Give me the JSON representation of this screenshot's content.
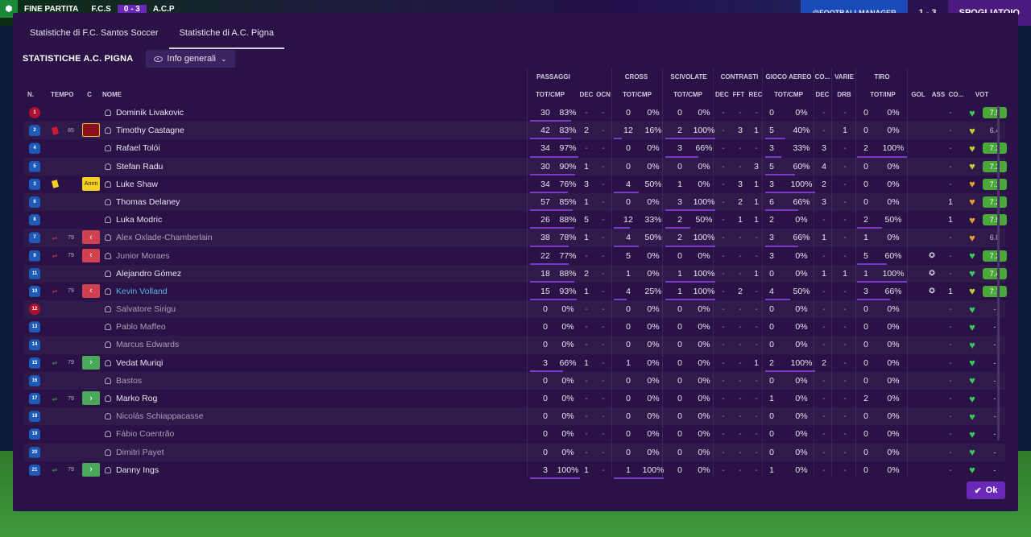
{
  "topbar": {
    "match_status": "FINE PARTITA",
    "home_short": "F.C.S",
    "score": "0 - 3",
    "away_short": "A.C.P",
    "right_score": "1 - 3",
    "right_label": "SPOGLIATOIO",
    "social": "@FOOTBALLMANAGER"
  },
  "tabs": [
    {
      "label": "Statistiche di F.C. Santos Soccer"
    },
    {
      "label": "Statistiche di A.C. Pigna"
    }
  ],
  "title": "STATISTICHE A.C. PIGNA",
  "view_dropdown": "Info generali",
  "ok_label": "Ok",
  "groups": [
    "PASSAGGI",
    "CROSS",
    "SCIVOLATE",
    "CONTRASTI",
    "GIOCO AEREO",
    "CO...",
    "VARIE",
    "TIRO"
  ],
  "columns": {
    "n": "N.",
    "tempo": "TEMPO",
    "c": "C",
    "nome": "NOME",
    "pass_totcmp": "TOT/CMP",
    "pass_dec": "DEC",
    "pass_ocn": "OCN",
    "cross_totcmp": "TOT/CMP",
    "sciv_totcmp": "TOT/CMP",
    "con_dec": "DEC",
    "con_fft": "FFT",
    "con_rec": "REC",
    "aereo_totcmp": "TOT/CMP",
    "co_dec": "DEC",
    "varie_drb": "DRB",
    "tiro_totinp": "TOT/INP",
    "gol": "GOL",
    "ass": "ASS",
    "co": "CO...",
    "vot": "VOT"
  },
  "players": [
    {
      "n": "1",
      "type": "gk",
      "name": "Dominik Livakovic",
      "style": "normal",
      "minute": "",
      "card": "",
      "cbox": "",
      "p_tot": "30",
      "p_pct": "83%",
      "p_bar": 0.83,
      "p_dec": "-",
      "p_ocn": "-",
      "cr_tot": "0",
      "cr_pct": "0%",
      "cr_bar": 0,
      "sc_tot": "0",
      "sc_pct": "0%",
      "sc_bar": 0,
      "c_dec": "-",
      "c_fft": "-",
      "c_rec": "-",
      "a_tot": "0",
      "a_pct": "0%",
      "a_bar": 0,
      "co_dec": "-",
      "drb": "-",
      "t_tot": "0",
      "t_pct": "0%",
      "t_bar": 0,
      "gol": "",
      "ass": "-",
      "heart": "green",
      "vote": "7.5",
      "vote_style": "g"
    },
    {
      "n": "2",
      "type": "out",
      "name": "Timothy Castagne",
      "style": "normal",
      "minute": "85",
      "card": "red",
      "cbox": "red",
      "cbox_label": "",
      "p_tot": "42",
      "p_pct": "83%",
      "p_bar": 0.83,
      "p_dec": "2",
      "p_ocn": "-",
      "cr_tot": "12",
      "cr_pct": "16%",
      "cr_bar": 0.16,
      "sc_tot": "2",
      "sc_pct": "100%",
      "sc_bar": 1,
      "c_dec": "-",
      "c_fft": "3",
      "c_rec": "1",
      "a_tot": "5",
      "a_pct": "40%",
      "a_bar": 0.4,
      "co_dec": "-",
      "drb": "1",
      "t_tot": "0",
      "t_pct": "0%",
      "t_bar": 0,
      "gol": "",
      "ass": "-",
      "heart": "yellow",
      "vote": "6.4",
      "vote_style": "n"
    },
    {
      "n": "4",
      "type": "out",
      "name": "Rafael Tolói",
      "style": "normal",
      "minute": "",
      "card": "",
      "cbox": "",
      "p_tot": "34",
      "p_pct": "97%",
      "p_bar": 0.97,
      "p_dec": "-",
      "p_ocn": "-",
      "cr_tot": "0",
      "cr_pct": "0%",
      "cr_bar": 0,
      "sc_tot": "3",
      "sc_pct": "66%",
      "sc_bar": 0.66,
      "c_dec": "-",
      "c_fft": "-",
      "c_rec": "-",
      "a_tot": "3",
      "a_pct": "33%",
      "a_bar": 0.33,
      "co_dec": "3",
      "drb": "-",
      "t_tot": "2",
      "t_pct": "100%",
      "t_bar": 1,
      "gol": "",
      "ass": "-",
      "heart": "yellow",
      "vote": "7.3",
      "vote_style": "g"
    },
    {
      "n": "5",
      "type": "out",
      "name": "Stefan Radu",
      "style": "normal",
      "minute": "",
      "card": "",
      "cbox": "",
      "p_tot": "30",
      "p_pct": "90%",
      "p_bar": 0.9,
      "p_dec": "1",
      "p_ocn": "-",
      "cr_tot": "0",
      "cr_pct": "0%",
      "cr_bar": 0,
      "sc_tot": "0",
      "sc_pct": "0%",
      "sc_bar": 0,
      "c_dec": "-",
      "c_fft": "-",
      "c_rec": "3",
      "a_tot": "5",
      "a_pct": "60%",
      "a_bar": 0.6,
      "co_dec": "4",
      "drb": "-",
      "t_tot": "0",
      "t_pct": "0%",
      "t_bar": 0,
      "gol": "",
      "ass": "-",
      "heart": "yellow",
      "vote": "7.3",
      "vote_style": "g"
    },
    {
      "n": "3",
      "type": "out",
      "name": "Luke Shaw",
      "style": "normal",
      "minute": "",
      "card": "yellow",
      "cbox": "yel",
      "cbox_label": "Amm",
      "p_tot": "34",
      "p_pct": "76%",
      "p_bar": 0.76,
      "p_dec": "3",
      "p_ocn": "-",
      "cr_tot": "4",
      "cr_pct": "50%",
      "cr_bar": 0.5,
      "sc_tot": "1",
      "sc_pct": "0%",
      "sc_bar": 0,
      "c_dec": "-",
      "c_fft": "3",
      "c_rec": "1",
      "a_tot": "3",
      "a_pct": "100%",
      "a_bar": 1,
      "co_dec": "2",
      "drb": "-",
      "t_tot": "0",
      "t_pct": "0%",
      "t_bar": 0,
      "gol": "",
      "ass": "-",
      "heart": "orange",
      "vote": "7.1",
      "vote_style": "g"
    },
    {
      "n": "6",
      "type": "out",
      "name": "Thomas Delaney",
      "style": "normal",
      "minute": "",
      "card": "",
      "cbox": "",
      "p_tot": "57",
      "p_pct": "85%",
      "p_bar": 0.85,
      "p_dec": "1",
      "p_ocn": "-",
      "cr_tot": "0",
      "cr_pct": "0%",
      "cr_bar": 0,
      "sc_tot": "3",
      "sc_pct": "100%",
      "sc_bar": 1,
      "c_dec": "-",
      "c_fft": "2",
      "c_rec": "1",
      "a_tot": "6",
      "a_pct": "66%",
      "a_bar": 0.66,
      "co_dec": "3",
      "drb": "-",
      "t_tot": "0",
      "t_pct": "0%",
      "t_bar": 0,
      "gol": "",
      "ass": "1",
      "heart": "orange",
      "vote": "7.2",
      "vote_style": "g"
    },
    {
      "n": "8",
      "type": "out",
      "name": "Luka Modric",
      "style": "normal",
      "minute": "",
      "card": "",
      "cbox": "",
      "p_tot": "26",
      "p_pct": "88%",
      "p_bar": 0.88,
      "p_dec": "5",
      "p_ocn": "-",
      "cr_tot": "12",
      "cr_pct": "33%",
      "cr_bar": 0.33,
      "sc_tot": "2",
      "sc_pct": "50%",
      "sc_bar": 0.5,
      "c_dec": "-",
      "c_fft": "1",
      "c_rec": "1",
      "a_tot": "2",
      "a_pct": "0%",
      "a_bar": 0,
      "co_dec": "-",
      "drb": "-",
      "t_tot": "2",
      "t_pct": "50%",
      "t_bar": 0.5,
      "gol": "",
      "ass": "1",
      "heart": "orange",
      "vote": "7.5",
      "vote_style": "g"
    },
    {
      "n": "7",
      "type": "out",
      "name": "Alex Oxlade-Chamberlain",
      "style": "dim",
      "minute": "79",
      "sub": "out",
      "cbox": "out",
      "p_tot": "38",
      "p_pct": "78%",
      "p_bar": 0.78,
      "p_dec": "1",
      "p_ocn": "-",
      "cr_tot": "4",
      "cr_pct": "50%",
      "cr_bar": 0.5,
      "sc_tot": "2",
      "sc_pct": "100%",
      "sc_bar": 1,
      "c_dec": "-",
      "c_fft": "-",
      "c_rec": "-",
      "a_tot": "3",
      "a_pct": "66%",
      "a_bar": 0.66,
      "co_dec": "1",
      "drb": "-",
      "t_tot": "1",
      "t_pct": "0%",
      "t_bar": 0,
      "gol": "",
      "ass": "-",
      "heart": "orange",
      "vote": "6.8",
      "vote_style": "n"
    },
    {
      "n": "9",
      "type": "out",
      "name": "Junior Moraes",
      "style": "dim",
      "minute": "79",
      "sub": "out",
      "cbox": "out",
      "p_tot": "22",
      "p_pct": "77%",
      "p_bar": 0.77,
      "p_dec": "-",
      "p_ocn": "-",
      "cr_tot": "5",
      "cr_pct": "0%",
      "cr_bar": 0,
      "sc_tot": "0",
      "sc_pct": "0%",
      "sc_bar": 0,
      "c_dec": "-",
      "c_fft": "-",
      "c_rec": "-",
      "a_tot": "3",
      "a_pct": "0%",
      "a_bar": 0,
      "co_dec": "-",
      "drb": "-",
      "t_tot": "5",
      "t_pct": "60%",
      "t_bar": 0.6,
      "gol": "ball",
      "ass": "-",
      "heart": "green",
      "vote": "7.2",
      "vote_style": "g"
    },
    {
      "n": "11",
      "type": "out",
      "name": "Alejandro Gómez",
      "style": "normal",
      "minute": "",
      "card": "",
      "cbox": "",
      "p_tot": "18",
      "p_pct": "88%",
      "p_bar": 0.88,
      "p_dec": "2",
      "p_ocn": "-",
      "cr_tot": "1",
      "cr_pct": "0%",
      "cr_bar": 0,
      "sc_tot": "1",
      "sc_pct": "100%",
      "sc_bar": 1,
      "c_dec": "-",
      "c_fft": "-",
      "c_rec": "1",
      "a_tot": "0",
      "a_pct": "0%",
      "a_bar": 0,
      "co_dec": "1",
      "drb": "1",
      "t_tot": "1",
      "t_pct": "100%",
      "t_bar": 1,
      "gol": "ball",
      "ass": "-",
      "heart": "green",
      "vote": "7.4",
      "vote_style": "g"
    },
    {
      "n": "10",
      "type": "out",
      "name": "Kevin Volland",
      "style": "blue",
      "minute": "79",
      "sub": "out",
      "cbox": "out",
      "p_tot": "15",
      "p_pct": "93%",
      "p_bar": 0.93,
      "p_dec": "1",
      "p_ocn": "-",
      "cr_tot": "4",
      "cr_pct": "25%",
      "cr_bar": 0.25,
      "sc_tot": "1",
      "sc_pct": "100%",
      "sc_bar": 1,
      "c_dec": "-",
      "c_fft": "2",
      "c_rec": "-",
      "a_tot": "4",
      "a_pct": "50%",
      "a_bar": 0.5,
      "co_dec": "-",
      "drb": "-",
      "t_tot": "3",
      "t_pct": "66%",
      "t_bar": 0.66,
      "gol": "ball",
      "ass": "1",
      "heart": "yellow",
      "vote": "7.7",
      "vote_style": "g"
    },
    {
      "n": "12",
      "type": "gk",
      "name": "Salvatore Sirigu",
      "style": "dim",
      "minute": "",
      "card": "",
      "cbox": "",
      "p_tot": "0",
      "p_pct": "0%",
      "p_bar": 0,
      "p_dec": "-",
      "p_ocn": "-",
      "cr_tot": "0",
      "cr_pct": "0%",
      "cr_bar": 0,
      "sc_tot": "0",
      "sc_pct": "0%",
      "sc_bar": 0,
      "c_dec": "-",
      "c_fft": "-",
      "c_rec": "-",
      "a_tot": "0",
      "a_pct": "0%",
      "a_bar": 0,
      "co_dec": "-",
      "drb": "-",
      "t_tot": "0",
      "t_pct": "0%",
      "t_bar": 0,
      "gol": "",
      "ass": "-",
      "heart": "green",
      "vote": "-",
      "vote_style": "n"
    },
    {
      "n": "13",
      "type": "out",
      "name": "Pablo Maffeo",
      "style": "dim",
      "minute": "",
      "card": "",
      "cbox": "",
      "p_tot": "0",
      "p_pct": "0%",
      "p_bar": 0,
      "p_dec": "-",
      "p_ocn": "-",
      "cr_tot": "0",
      "cr_pct": "0%",
      "cr_bar": 0,
      "sc_tot": "0",
      "sc_pct": "0%",
      "sc_bar": 0,
      "c_dec": "-",
      "c_fft": "-",
      "c_rec": "-",
      "a_tot": "0",
      "a_pct": "0%",
      "a_bar": 0,
      "co_dec": "-",
      "drb": "-",
      "t_tot": "0",
      "t_pct": "0%",
      "t_bar": 0,
      "gol": "",
      "ass": "-",
      "heart": "green",
      "vote": "-",
      "vote_style": "n"
    },
    {
      "n": "14",
      "type": "out",
      "name": "Marcus Edwards",
      "style": "dim",
      "minute": "",
      "card": "",
      "cbox": "",
      "p_tot": "0",
      "p_pct": "0%",
      "p_bar": 0,
      "p_dec": "-",
      "p_ocn": "-",
      "cr_tot": "0",
      "cr_pct": "0%",
      "cr_bar": 0,
      "sc_tot": "0",
      "sc_pct": "0%",
      "sc_bar": 0,
      "c_dec": "-",
      "c_fft": "-",
      "c_rec": "-",
      "a_tot": "0",
      "a_pct": "0%",
      "a_bar": 0,
      "co_dec": "-",
      "drb": "-",
      "t_tot": "0",
      "t_pct": "0%",
      "t_bar": 0,
      "gol": "",
      "ass": "-",
      "heart": "green",
      "vote": "-",
      "vote_style": "n"
    },
    {
      "n": "15",
      "type": "out",
      "name": "Vedat Muriqi",
      "style": "normal",
      "minute": "79",
      "sub": "in",
      "cbox": "in",
      "p_tot": "3",
      "p_pct": "66%",
      "p_bar": 0.66,
      "p_dec": "1",
      "p_ocn": "-",
      "cr_tot": "1",
      "cr_pct": "0%",
      "cr_bar": 0,
      "sc_tot": "0",
      "sc_pct": "0%",
      "sc_bar": 0,
      "c_dec": "-",
      "c_fft": "-",
      "c_rec": "1",
      "a_tot": "2",
      "a_pct": "100%",
      "a_bar": 1,
      "co_dec": "2",
      "drb": "-",
      "t_tot": "0",
      "t_pct": "0%",
      "t_bar": 0,
      "gol": "",
      "ass": "-",
      "heart": "green",
      "vote": "-",
      "vote_style": "n"
    },
    {
      "n": "16",
      "type": "out",
      "name": "Bastos",
      "style": "dim",
      "minute": "",
      "card": "",
      "cbox": "",
      "p_tot": "0",
      "p_pct": "0%",
      "p_bar": 0,
      "p_dec": "-",
      "p_ocn": "-",
      "cr_tot": "0",
      "cr_pct": "0%",
      "cr_bar": 0,
      "sc_tot": "0",
      "sc_pct": "0%",
      "sc_bar": 0,
      "c_dec": "-",
      "c_fft": "-",
      "c_rec": "-",
      "a_tot": "0",
      "a_pct": "0%",
      "a_bar": 0,
      "co_dec": "-",
      "drb": "-",
      "t_tot": "0",
      "t_pct": "0%",
      "t_bar": 0,
      "gol": "",
      "ass": "-",
      "heart": "green",
      "vote": "-",
      "vote_style": "n"
    },
    {
      "n": "17",
      "type": "out",
      "name": "Marko Rog",
      "style": "normal",
      "minute": "79",
      "sub": "in",
      "cbox": "in",
      "p_tot": "0",
      "p_pct": "0%",
      "p_bar": 0,
      "p_dec": "-",
      "p_ocn": "-",
      "cr_tot": "0",
      "cr_pct": "0%",
      "cr_bar": 0,
      "sc_tot": "0",
      "sc_pct": "0%",
      "sc_bar": 0,
      "c_dec": "-",
      "c_fft": "-",
      "c_rec": "-",
      "a_tot": "1",
      "a_pct": "0%",
      "a_bar": 0,
      "co_dec": "-",
      "drb": "-",
      "t_tot": "2",
      "t_pct": "0%",
      "t_bar": 0,
      "gol": "",
      "ass": "-",
      "heart": "green",
      "vote": "-",
      "vote_style": "n"
    },
    {
      "n": "18",
      "type": "out",
      "name": "Nicolás Schiappacasse",
      "style": "dim",
      "minute": "",
      "card": "",
      "cbox": "",
      "p_tot": "0",
      "p_pct": "0%",
      "p_bar": 0,
      "p_dec": "-",
      "p_ocn": "-",
      "cr_tot": "0",
      "cr_pct": "0%",
      "cr_bar": 0,
      "sc_tot": "0",
      "sc_pct": "0%",
      "sc_bar": 0,
      "c_dec": "-",
      "c_fft": "-",
      "c_rec": "-",
      "a_tot": "0",
      "a_pct": "0%",
      "a_bar": 0,
      "co_dec": "-",
      "drb": "-",
      "t_tot": "0",
      "t_pct": "0%",
      "t_bar": 0,
      "gol": "",
      "ass": "-",
      "heart": "green",
      "vote": "-",
      "vote_style": "n"
    },
    {
      "n": "19",
      "type": "out",
      "name": "Fábio Coentrão",
      "style": "dim",
      "minute": "",
      "card": "",
      "cbox": "",
      "p_tot": "0",
      "p_pct": "0%",
      "p_bar": 0,
      "p_dec": "-",
      "p_ocn": "-",
      "cr_tot": "0",
      "cr_pct": "0%",
      "cr_bar": 0,
      "sc_tot": "0",
      "sc_pct": "0%",
      "sc_bar": 0,
      "c_dec": "-",
      "c_fft": "-",
      "c_rec": "-",
      "a_tot": "0",
      "a_pct": "0%",
      "a_bar": 0,
      "co_dec": "-",
      "drb": "-",
      "t_tot": "0",
      "t_pct": "0%",
      "t_bar": 0,
      "gol": "",
      "ass": "-",
      "heart": "green",
      "vote": "-",
      "vote_style": "n"
    },
    {
      "n": "20",
      "type": "out",
      "name": "Dimitri Payet",
      "style": "dim",
      "minute": "",
      "card": "",
      "cbox": "",
      "p_tot": "0",
      "p_pct": "0%",
      "p_bar": 0,
      "p_dec": "-",
      "p_ocn": "-",
      "cr_tot": "0",
      "cr_pct": "0%",
      "cr_bar": 0,
      "sc_tot": "0",
      "sc_pct": "0%",
      "sc_bar": 0,
      "c_dec": "-",
      "c_fft": "-",
      "c_rec": "-",
      "a_tot": "0",
      "a_pct": "0%",
      "a_bar": 0,
      "co_dec": "-",
      "drb": "-",
      "t_tot": "0",
      "t_pct": "0%",
      "t_bar": 0,
      "gol": "",
      "ass": "-",
      "heart": "green",
      "vote": "-",
      "vote_style": "n"
    },
    {
      "n": "21",
      "type": "out",
      "name": "Danny Ings",
      "style": "normal",
      "minute": "79",
      "sub": "in",
      "cbox": "in",
      "p_tot": "3",
      "p_pct": "100%",
      "p_bar": 1,
      "p_dec": "1",
      "p_ocn": "-",
      "cr_tot": "1",
      "cr_pct": "100%",
      "cr_bar": 1,
      "sc_tot": "0",
      "sc_pct": "0%",
      "sc_bar": 0,
      "c_dec": "-",
      "c_fft": "-",
      "c_rec": "-",
      "a_tot": "1",
      "a_pct": "0%",
      "a_bar": 0,
      "co_dec": "-",
      "drb": "-",
      "t_tot": "0",
      "t_pct": "0%",
      "t_bar": 0,
      "gol": "",
      "ass": "-",
      "heart": "green",
      "vote": "-",
      "vote_style": "n"
    }
  ],
  "colors": {
    "accent": "#7a3ac8",
    "vote_green": "#4aa83a",
    "card_yellow": "#f4d020",
    "card_red": "#d01830",
    "sub_out": "#d04050",
    "sub_in": "#4aa85a",
    "heart_green": "#3ac85a",
    "heart_yellow": "#b8d030",
    "heart_orange": "#e0a030"
  }
}
